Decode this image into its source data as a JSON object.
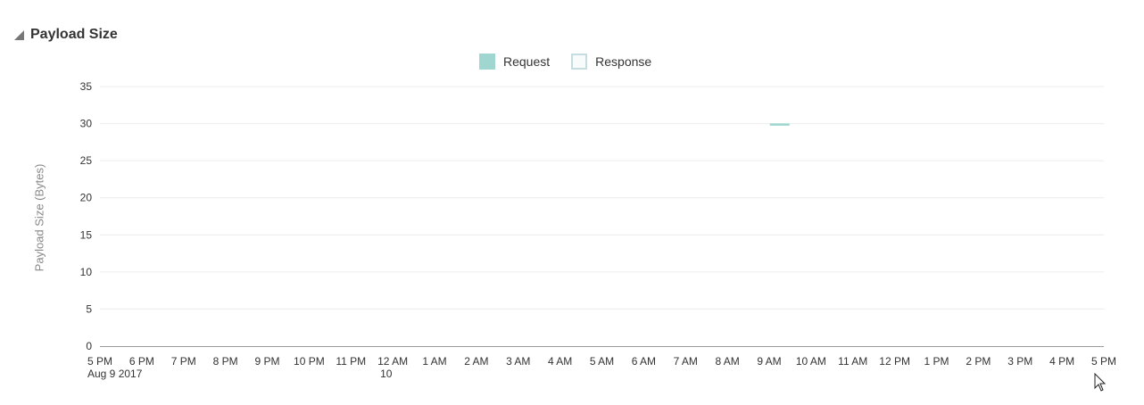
{
  "section": {
    "title": "Payload Size"
  },
  "icons": {
    "collapse": "collapse-triangle-icon",
    "cursor": "mouse-pointer-icon"
  },
  "colors": {
    "request": "#9fd6d0",
    "response_border": "#c6dcdf",
    "grid": "#ececec",
    "axis": "#9a9a9a",
    "tick_text": "#333333"
  },
  "chart_data": {
    "type": "bar",
    "ylabel": "Payload Size (Bytes)",
    "xlabel": "",
    "ylim": [
      0,
      35
    ],
    "yticks": [
      0,
      5,
      10,
      15,
      20,
      25,
      30,
      35
    ],
    "grid": true,
    "legend_position": "top-center",
    "x_ticks": [
      "5 PM",
      "6 PM",
      "7 PM",
      "8 PM",
      "9 PM",
      "10 PM",
      "11 PM",
      "12 AM",
      "1 AM",
      "2 AM",
      "3 AM",
      "4 AM",
      "5 AM",
      "6 AM",
      "7 AM",
      "8 AM",
      "9 AM",
      "10 AM",
      "11 AM",
      "12 PM",
      "1 PM",
      "2 PM",
      "3 PM",
      "4 PM",
      "5 PM"
    ],
    "x_sublabels": [
      {
        "tick": "5 PM",
        "text": "Aug 9 2017"
      },
      {
        "tick": "12 AM",
        "text": "10"
      }
    ],
    "series": [
      {
        "name": "Request",
        "points": [
          {
            "time": "Aug 10 2017 9:00 AM",
            "value": 30
          }
        ]
      },
      {
        "name": "Response",
        "points": []
      }
    ]
  }
}
